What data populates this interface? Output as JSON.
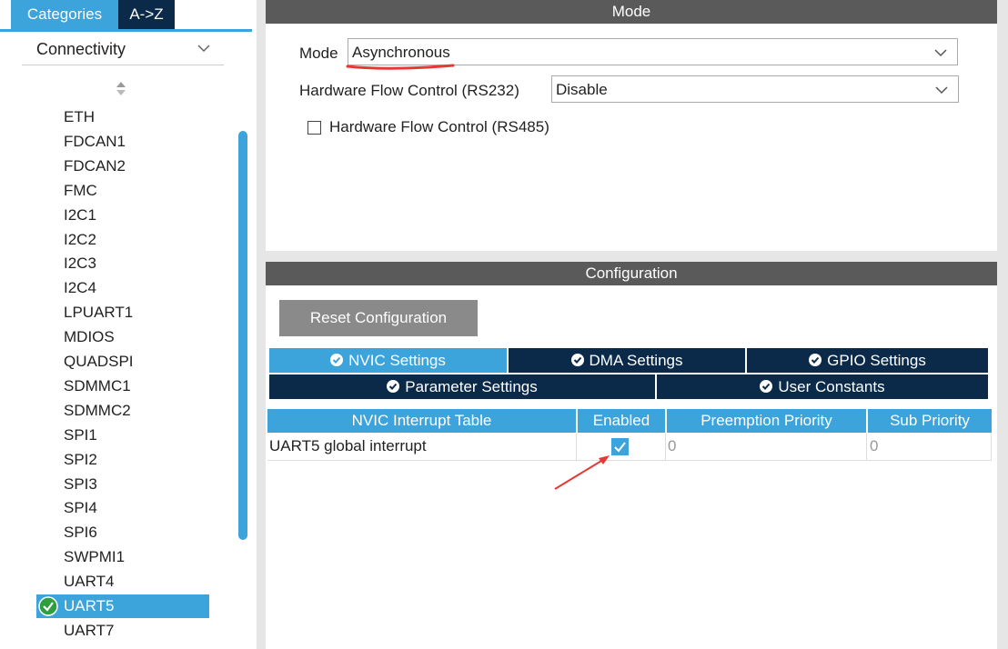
{
  "categories_tabs": {
    "categories": "Categories",
    "az": "A->Z"
  },
  "group": {
    "label": "Connectivity"
  },
  "peripherals": [
    "ETH",
    "FDCAN1",
    "FDCAN2",
    "FMC",
    "I2C1",
    "I2C2",
    "I2C3",
    "I2C4",
    "LPUART1",
    "MDIOS",
    "QUADSPI",
    "SDMMC1",
    "SDMMC2",
    "SPI1",
    "SPI2",
    "SPI3",
    "SPI4",
    "SPI6",
    "SWPMI1",
    "UART4",
    "UART5",
    "UART7"
  ],
  "selected_peripheral": "UART5",
  "mode_panel": {
    "header": "Mode",
    "mode_label": "Mode",
    "mode_value": "Asynchronous",
    "hwfc232_label": "Hardware Flow Control (RS232)",
    "hwfc232_value": "Disable",
    "hwfc485_label": "Hardware Flow Control (RS485)",
    "hwfc485_checked": false
  },
  "config_panel": {
    "header": "Configuration",
    "reset_label": "Reset Configuration",
    "tabs_row1": [
      "NVIC Settings",
      "DMA Settings",
      "GPIO Settings"
    ],
    "tabs_row2": [
      "Parameter Settings",
      "User Constants"
    ],
    "active_tab": "NVIC Settings",
    "table": {
      "columns": [
        "NVIC Interrupt Table",
        "Enabled",
        "Preemption Priority",
        "Sub Priority"
      ],
      "rows": [
        {
          "name": "UART5 global interrupt",
          "enabled": true,
          "preemption": "0",
          "sub": "0"
        }
      ]
    }
  },
  "colors": {
    "accent": "#3ca3db",
    "dark_tab": "#0b2a4a",
    "header": "#5a5a5a",
    "annotation": "#e53935"
  }
}
